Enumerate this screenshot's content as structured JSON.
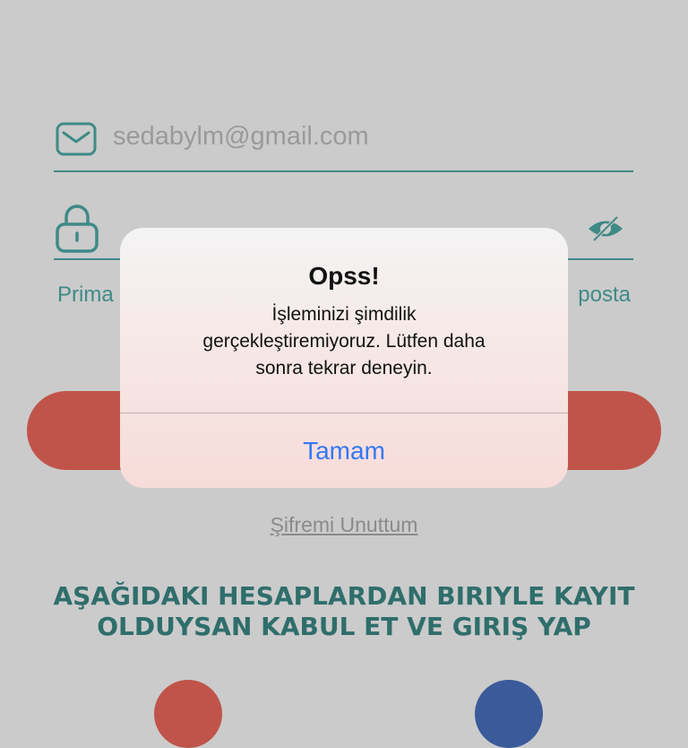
{
  "login": {
    "email_value": "sedabylm@gmail.com",
    "remember_label_partial": "Prima",
    "email_label_partial": "posta",
    "forgot_password": "Şifremi Unuttum",
    "social_heading_line1": "AŞAĞIDAKI HESAPLARDAN BIRIYLE KAYIT",
    "social_heading_line2": "OLDUYSAN KABUL ET VE GIRIŞ YAP"
  },
  "alert": {
    "title": "Opss!",
    "message_line1": "İşleminizi şimdilik",
    "message_line2": "gerçekleştiremiyoruz. Lütfen daha",
    "message_line3": "sonra tekrar deneyin.",
    "button_label": "Tamam"
  },
  "colors": {
    "accent_teal": "#3f8a86",
    "button_red": "#c0544a",
    "alert_button_blue": "#3478f6"
  },
  "icons": {
    "email": "mail-icon",
    "password": "lock-icon",
    "visibility": "eye-off-icon"
  }
}
